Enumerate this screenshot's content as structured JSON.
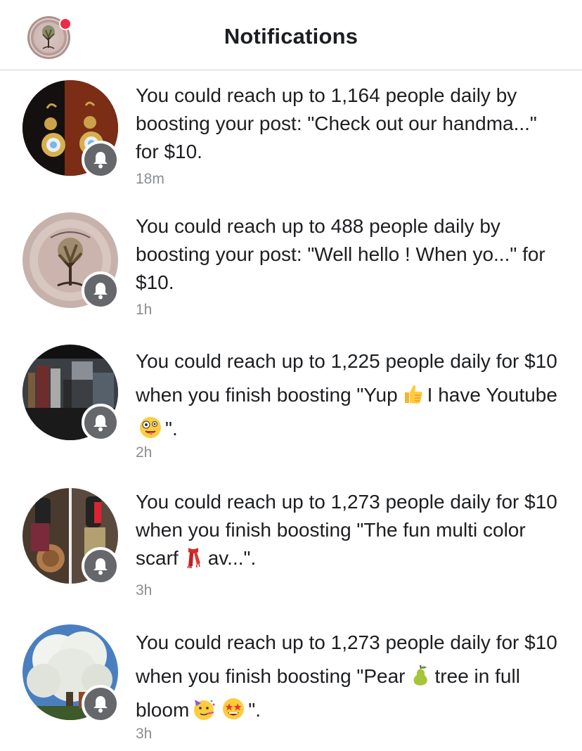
{
  "header": {
    "title": "Notifications",
    "has_unread_dot": true
  },
  "notifications": [
    {
      "text_before": "You could reach up to 1,164 people daily by boosting your post: \"Check out our handma...\" for $10.",
      "time": "18m",
      "avatar": "earrings-photo",
      "badge_icon": "bell-icon"
    },
    {
      "text_before": "You could reach up to 488 people daily by boosting your post: \"Well hello ! When yo...\" for $10.",
      "time": "1h",
      "avatar": "tree-logo-photo",
      "badge_icon": "bell-icon"
    },
    {
      "text_before": "You could reach up to 1,225 people daily for $10 when you finish boosting \"Yup",
      "emoji_1": "thumbs-up",
      "text_middle": "I have Youtube",
      "emoji_2": "zany-face",
      "text_after": "\".",
      "time": "2h",
      "avatar": "market-booth-photo",
      "badge_icon": "bell-icon"
    },
    {
      "text_before": "You could reach up to 1,273 people daily for $10 when you finish boosting \"The fun multi color scarf",
      "emoji_1": "scarf",
      "text_after": "av...\".",
      "time": "3h",
      "avatar": "crafts-photo",
      "badge_icon": "bell-icon"
    },
    {
      "text_before": "You could reach up to 1,273 people daily for $10 when you finish boosting \"Pear",
      "emoji_1": "pear",
      "text_middle": "tree in full bloom",
      "emoji_2": "partying-face",
      "emoji_3": "star-struck",
      "text_after": "\".",
      "time": "3h",
      "avatar": "pear-tree-photo",
      "badge_icon": "bell-icon"
    }
  ],
  "colors": {
    "badge": "#65676b",
    "unread_dot": "#f02849",
    "time_text": "#8a8d91",
    "divider": "#cfd1d5"
  }
}
